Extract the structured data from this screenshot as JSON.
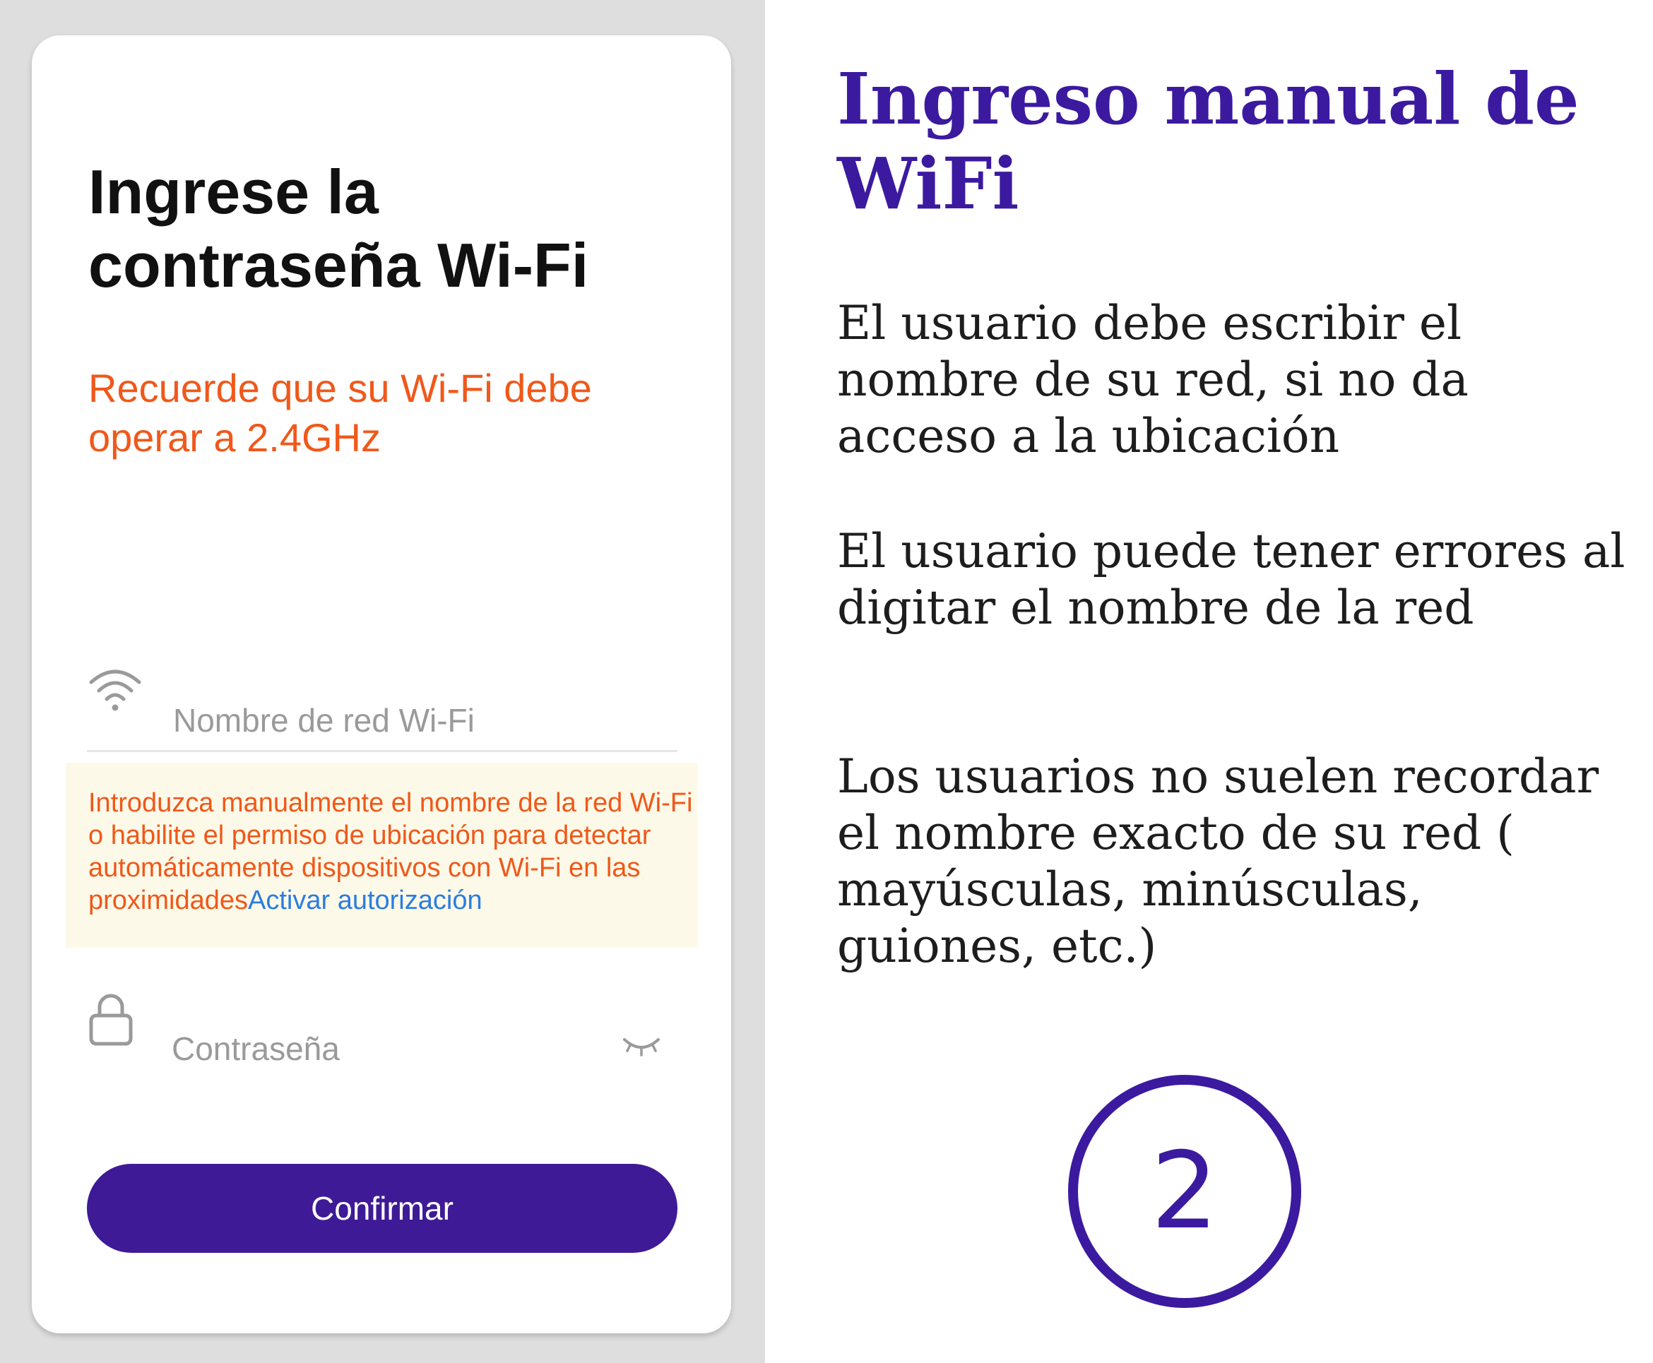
{
  "colors": {
    "accent": "#3e1a96",
    "warning": "#f0581a",
    "link": "#2a7de1",
    "heading": "#3b1aa0",
    "notice_bg": "#fdf9e8"
  },
  "screen": {
    "title": "Ingrese la contraseña Wi-Fi",
    "subtitle": "Recuerde que su Wi-Fi debe operar a 2.4GHz",
    "ssid_field": {
      "icon": "wifi-icon",
      "placeholder": "Nombre de red Wi-Fi",
      "value": ""
    },
    "notice": {
      "text": "Introduzca manualmente el nombre de la red Wi-Fi o habilite el permiso de ubicación para detectar automáticamente dispositivos con Wi-Fi en las proximidades",
      "link_label": "Activar autorización"
    },
    "password_field": {
      "icon": "lock-icon",
      "placeholder": "Contraseña",
      "value": "",
      "toggle_icon": "eye-closed-icon"
    },
    "confirm_label": "Confirmar"
  },
  "annotation": {
    "heading": "Ingreso manual de WiFi",
    "paragraphs": [
      "El usuario debe escribir el nombre de su red, si no da acceso a la ubicación",
      "El usuario puede tener errores al digitar el nombre de la red",
      "Los usuarios no suelen recordar el nombre exacto de su red ( mayúsculas, minúsculas, guiones, etc.)"
    ],
    "step_number": "2"
  }
}
